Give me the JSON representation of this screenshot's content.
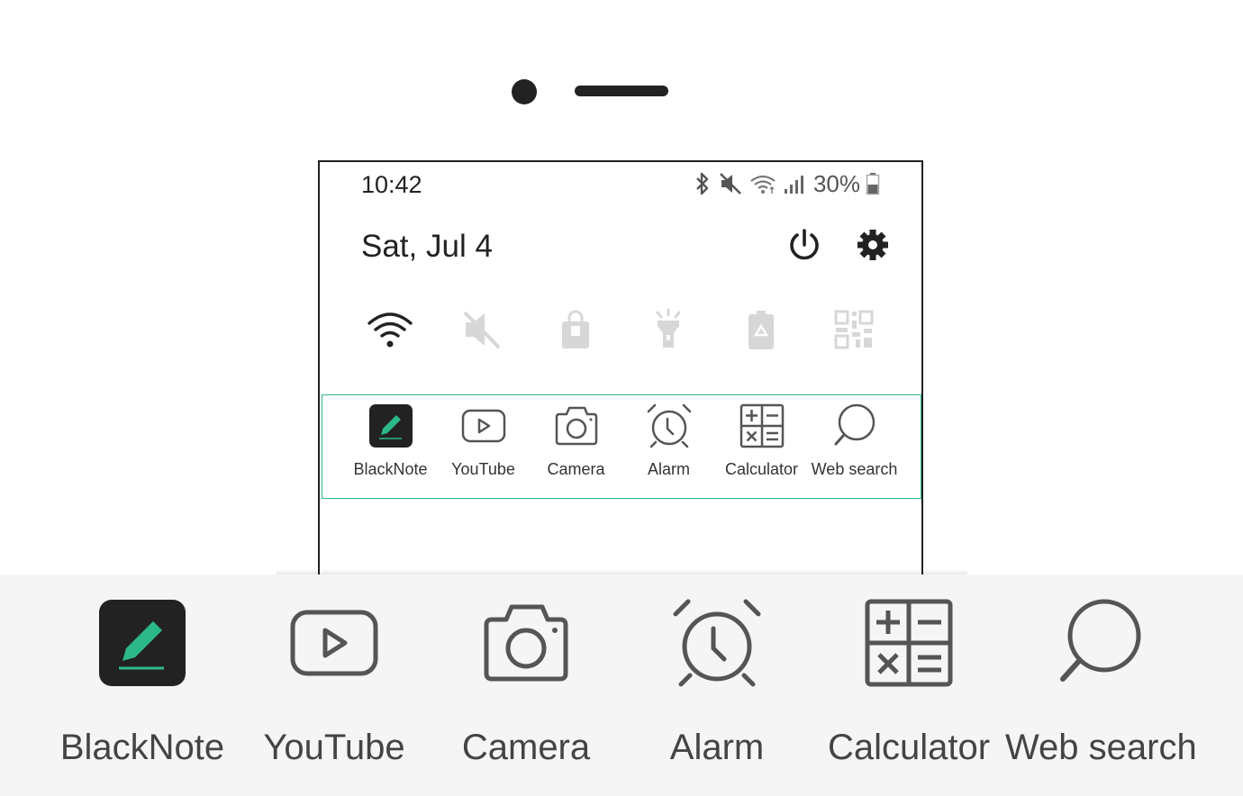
{
  "status_bar": {
    "time": "10:42",
    "battery": "30%",
    "icons": [
      "bluetooth-icon",
      "mute-icon",
      "wifi-icon",
      "signal-icon",
      "battery-icon"
    ]
  },
  "header": {
    "date": "Sat, Jul 4",
    "icons": [
      "power-icon",
      "settings-icon"
    ]
  },
  "quick_toggles": [
    {
      "name": "wifi",
      "icon": "wifi-icon",
      "active": true
    },
    {
      "name": "sound",
      "icon": "mute-icon",
      "active": false
    },
    {
      "name": "lock",
      "icon": "lock-icon",
      "active": false
    },
    {
      "name": "flashlight",
      "icon": "flashlight-icon",
      "active": false
    },
    {
      "name": "battery-saver",
      "icon": "battery-saver-icon",
      "active": false
    },
    {
      "name": "qr-scanner",
      "icon": "qr-code-icon",
      "active": false
    }
  ],
  "shortcuts": [
    {
      "label": "BlackNote",
      "icon": "pencil-note-icon"
    },
    {
      "label": "YouTube",
      "icon": "play-icon"
    },
    {
      "label": "Camera",
      "icon": "camera-icon"
    },
    {
      "label": "Alarm",
      "icon": "alarm-clock-icon"
    },
    {
      "label": "Calculator",
      "icon": "calculator-icon"
    },
    {
      "label": "Web search",
      "icon": "search-icon"
    }
  ],
  "colors": {
    "accent": "#2db88a",
    "icon_dark": "#222222",
    "icon_outline": "#555555",
    "toggle_inactive": "#d7d7d7",
    "zoom_panel_bg": "#f5f5f5"
  }
}
